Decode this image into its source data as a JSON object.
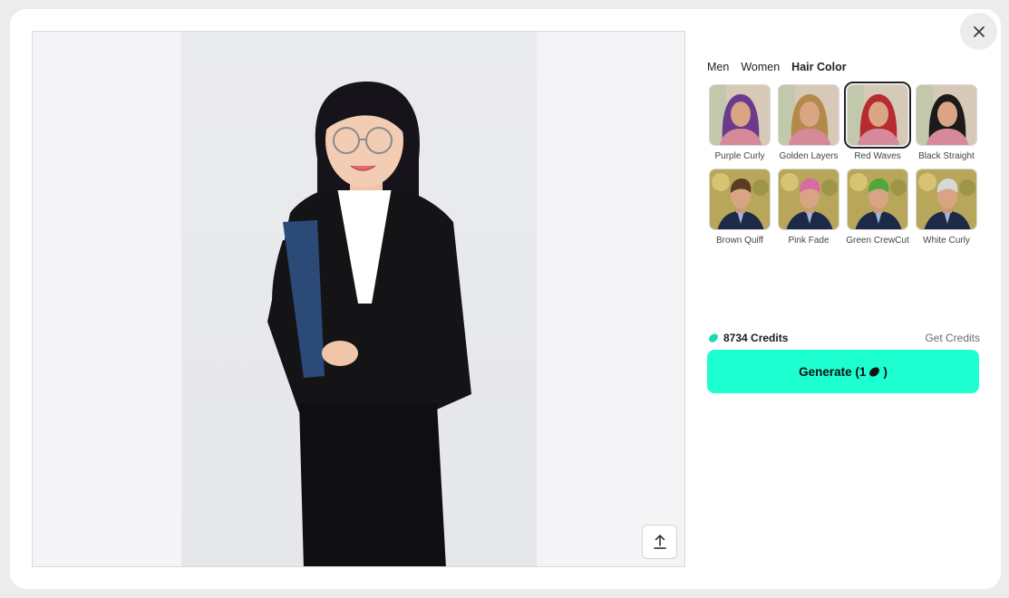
{
  "close": {
    "icon": "close-icon"
  },
  "preview": {
    "upload_icon": "upload-icon"
  },
  "tabs": [
    {
      "label": "Men",
      "active": false
    },
    {
      "label": "Women",
      "active": false
    },
    {
      "label": "Hair Color",
      "active": true
    }
  ],
  "styles": [
    {
      "label": "Purple Curly",
      "hair": "#6b3a8c",
      "type": "woman",
      "selected": false
    },
    {
      "label": "Golden Layers",
      "hair": "#b48a4a",
      "type": "woman",
      "selected": false
    },
    {
      "label": "Red Waves",
      "hair": "#b72a2f",
      "type": "woman",
      "selected": true
    },
    {
      "label": "Black Straight",
      "hair": "#1d1a1c",
      "type": "woman",
      "selected": false
    },
    {
      "label": "Brown Quiff",
      "hair": "#5a3b24",
      "type": "man",
      "selected": false
    },
    {
      "label": "Pink Fade",
      "hair": "#d96aa3",
      "type": "man",
      "selected": false
    },
    {
      "label": "Green CrewCut",
      "hair": "#4fa83a",
      "type": "man",
      "selected": false
    },
    {
      "label": "White Curly",
      "hair": "#d8d8d8",
      "type": "man",
      "selected": false
    }
  ],
  "credits": {
    "amount": "8734 Credits",
    "get_label": "Get Credits"
  },
  "generate": {
    "label": "Generate (1",
    "suffix": ")"
  },
  "colors": {
    "accent": "#1dffd0"
  }
}
